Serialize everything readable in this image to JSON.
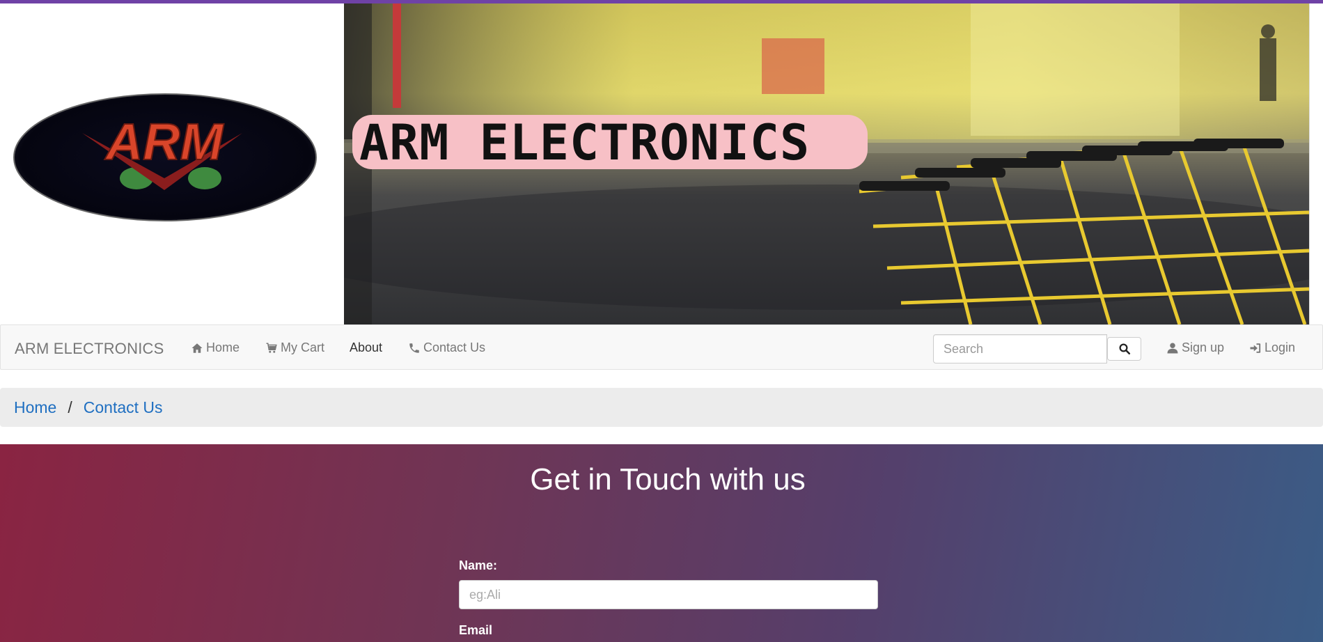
{
  "header": {
    "logo_text": "ARM",
    "banner_title": "ARM ELECTRONICS"
  },
  "navbar": {
    "brand": "ARM ELECTRONICS",
    "items": [
      {
        "label": "Home",
        "icon": "home-icon"
      },
      {
        "label": "My Cart",
        "icon": "cart-icon"
      },
      {
        "label": "About",
        "icon": ""
      },
      {
        "label": "Contact Us",
        "icon": "phone-icon"
      }
    ],
    "search_placeholder": "Search",
    "signup_label": "Sign up",
    "login_label": "Login"
  },
  "breadcrumb": {
    "items": [
      "Home",
      "Contact Us"
    ],
    "separator": "/"
  },
  "contact": {
    "title": "Get in Touch with us",
    "name_label": "Name:",
    "name_placeholder": "eg:Ali",
    "email_label": "Email"
  },
  "colors": {
    "accent_top": "#6f42a6",
    "link": "#1f6fc1",
    "gradient_start": "#8a2442",
    "gradient_end": "#3b5c86"
  }
}
